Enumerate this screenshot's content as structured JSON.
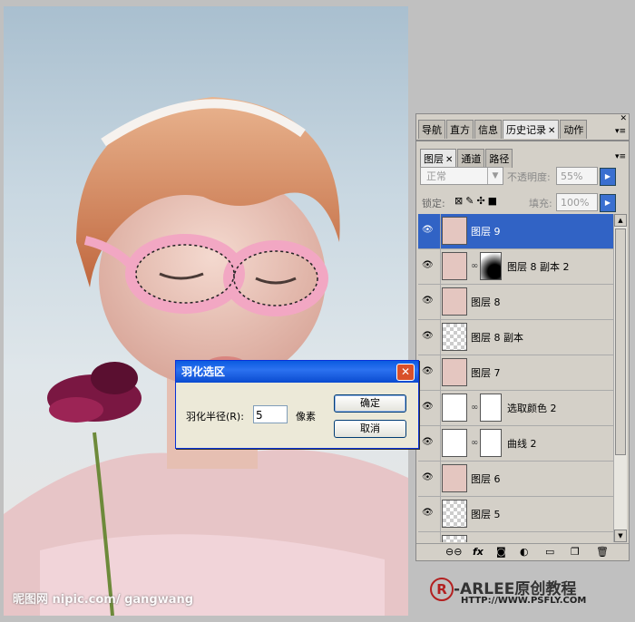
{
  "panel_top": {
    "tabs": [
      {
        "label": "导航"
      },
      {
        "label": "直方"
      },
      {
        "label": "信息"
      },
      {
        "label": "历史记录"
      },
      {
        "label": "动作"
      }
    ]
  },
  "layers_panel": {
    "tabs": [
      {
        "label": "图层"
      },
      {
        "label": "通道"
      },
      {
        "label": "路径"
      }
    ],
    "blend_mode": "正常",
    "opacity_label": "不透明度:",
    "opacity_value": "55%",
    "lock_label": "锁定:",
    "fill_label": "填充:",
    "fill_value": "100%",
    "layers": [
      {
        "name": "图层 9",
        "selected": true
      },
      {
        "name": "图层 8 副本 2"
      },
      {
        "name": "图层 8"
      },
      {
        "name": "图层 8 副本"
      },
      {
        "name": "图层 7"
      },
      {
        "name": "选取颜色 2"
      },
      {
        "name": "曲线 2"
      },
      {
        "name": "图层 6"
      },
      {
        "name": "图层 5"
      },
      {
        "name": "图层"
      }
    ]
  },
  "dialog": {
    "title": "羽化选区",
    "radius_label": "羽化半径(R):",
    "radius_value": "5",
    "unit": "像素",
    "ok_label": "确定",
    "cancel_label": "取消"
  },
  "watermark": "昵图网 nipic.com/ gangwang",
  "brand": {
    "symbol": "R",
    "name": "-ARLEE原创教程",
    "url": "HTTP://WWW.PSFLY.COM"
  },
  "colors": {
    "selection": "#3163c5",
    "brand_red": "#b32020",
    "titlebar": "#0a5be0"
  }
}
